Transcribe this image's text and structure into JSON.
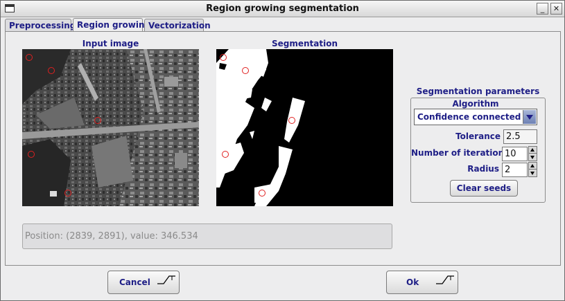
{
  "window": {
    "title": "Region growing segmentation"
  },
  "tabs": [
    {
      "label": "Preprocessing",
      "active": false
    },
    {
      "label": "Region growing",
      "active": true
    },
    {
      "label": "Vectorization",
      "active": false
    }
  ],
  "input_image": {
    "caption": "Input image"
  },
  "segmentation": {
    "caption": "Segmentation"
  },
  "status": {
    "text": "Position: (2839, 2891), value: 346.534"
  },
  "params": {
    "group_title": "Segmentation parameters",
    "algorithm_label": "Algorithm",
    "algorithm_value": "Confidence connected",
    "tolerance_label": "Tolerance",
    "tolerance_value": "2.5",
    "iterations_label": "Number of iterations",
    "iterations_value": "10",
    "radius_label": "Radius",
    "radius_value": "2",
    "clear_seeds_label": "Clear seeds"
  },
  "footer": {
    "cancel_label": "Cancel",
    "ok_label": "Ok"
  },
  "colors": {
    "accent_text": "#1e1e86",
    "seed_marker": "#e02020",
    "dropdown_button": "#6d80b4"
  }
}
